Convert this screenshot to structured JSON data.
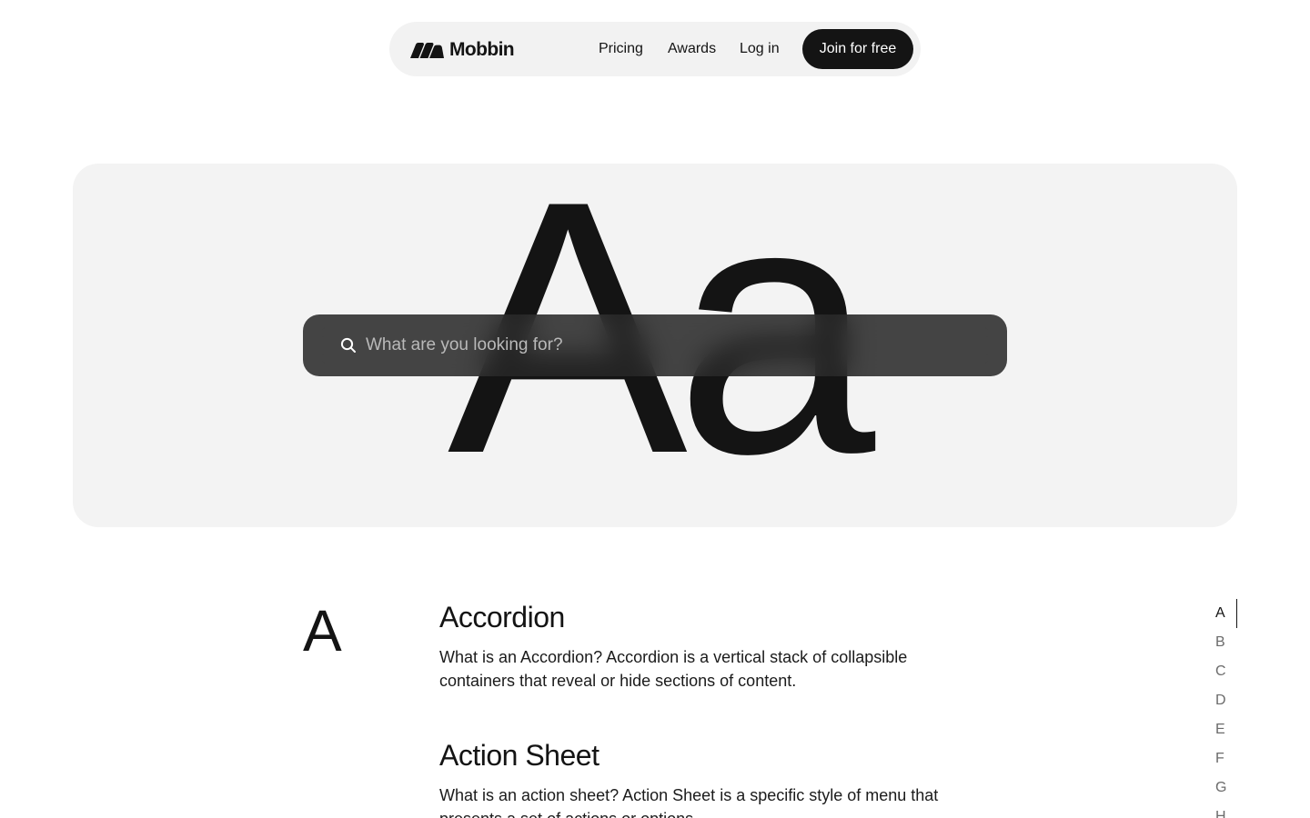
{
  "nav": {
    "brand": "Mobbin",
    "links": [
      "Pricing",
      "Awards",
      "Log in"
    ],
    "cta": "Join for free"
  },
  "hero": {
    "glyph": "Aa",
    "search_placeholder": "What are you looking for?"
  },
  "glossary": {
    "letter": "A",
    "terms": [
      {
        "title": "Accordion",
        "description": "What is an Accordion? Accordion is a vertical stack of collapsible containers that reveal or hide sections of content."
      },
      {
        "title": "Action Sheet",
        "description": "What is an action sheet? Action Sheet is a specific style of menu that presents a set of actions or options."
      }
    ]
  },
  "alphabet_index": {
    "active": "A",
    "letters": [
      "A",
      "B",
      "C",
      "D",
      "E",
      "F",
      "G",
      "H"
    ]
  },
  "colors": {
    "text": "#141414",
    "hero_bg": "#f3f3f3",
    "nav_bg": "#f2f2f2",
    "search_bg": "#262626",
    "cta_bg": "#141414"
  },
  "icons": [
    "mobbin-logo-icon",
    "search-icon"
  ]
}
